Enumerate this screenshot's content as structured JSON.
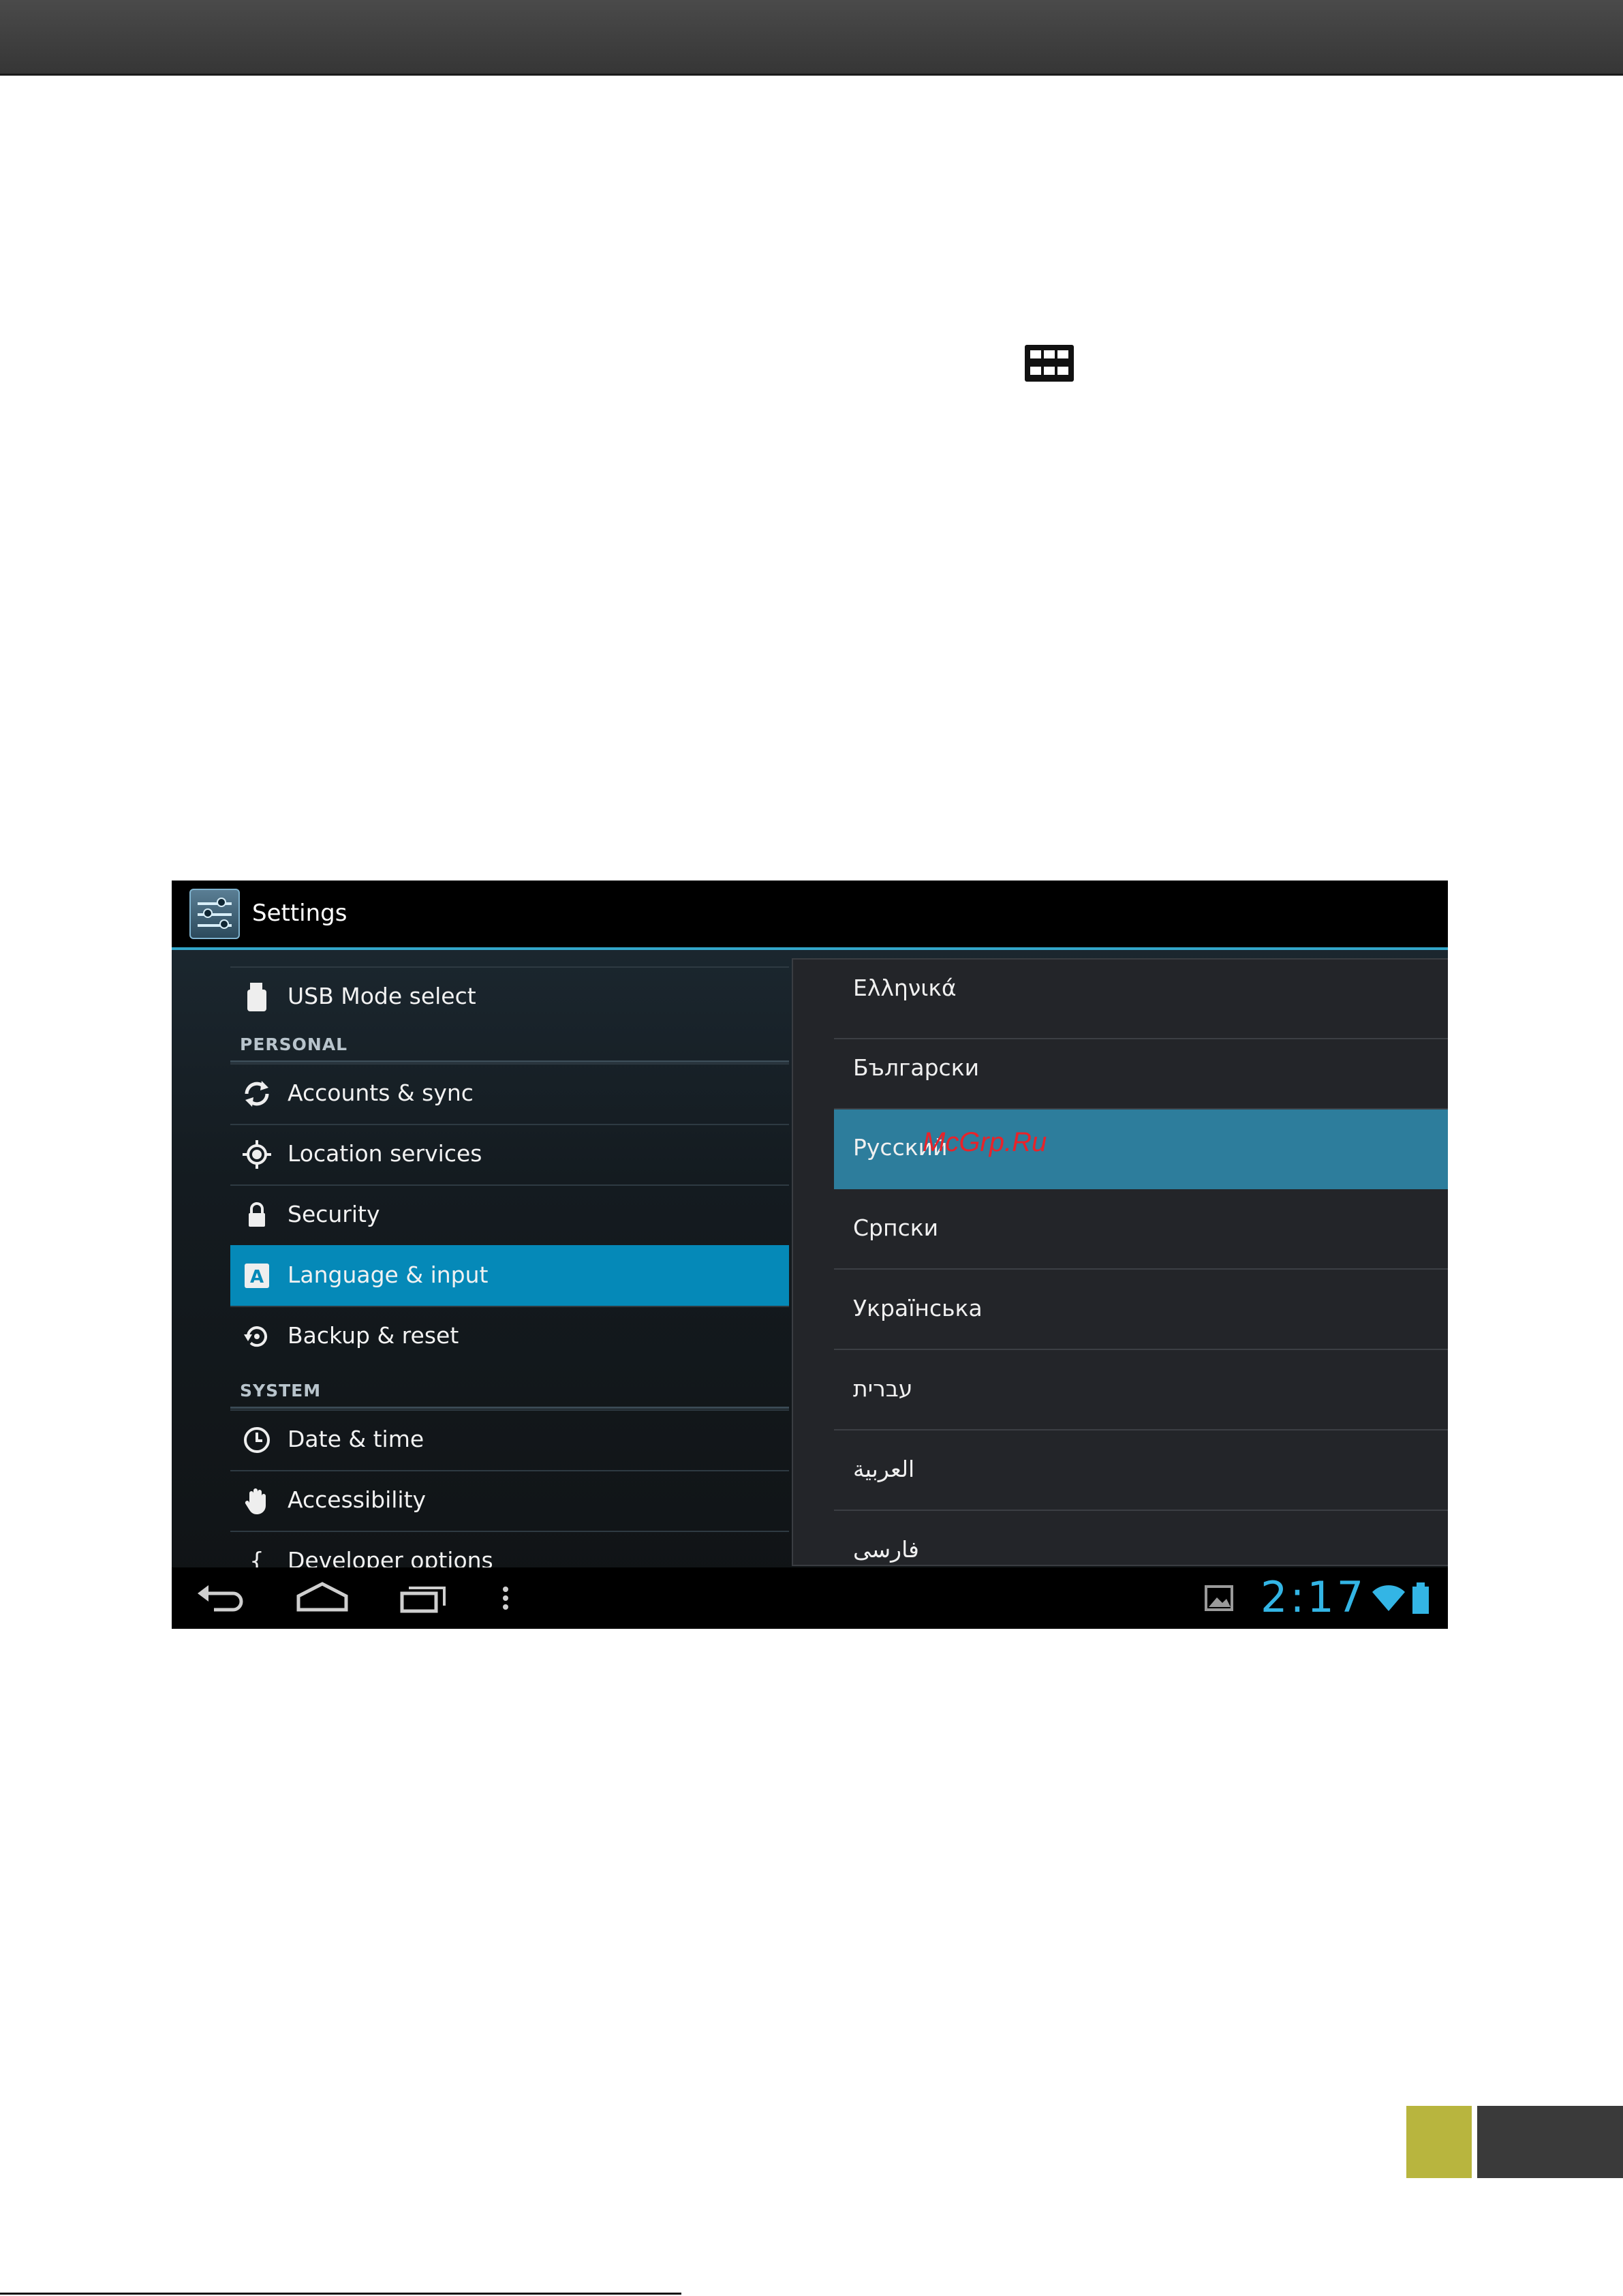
{
  "screen": {
    "app_title": "Settings",
    "settings": {
      "top_item": {
        "label": "USB Mode select",
        "icon": "usb-drive-icon"
      },
      "sections": [
        {
          "header": "PERSONAL",
          "items": [
            {
              "label": "Accounts & sync",
              "icon": "sync-icon"
            },
            {
              "label": "Location services",
              "icon": "location-icon"
            },
            {
              "label": "Security",
              "icon": "lock-icon"
            },
            {
              "label": "Language & input",
              "icon": "language-icon",
              "active": true
            },
            {
              "label": "Backup & reset",
              "icon": "backup-icon"
            }
          ]
        },
        {
          "header": "SYSTEM",
          "items": [
            {
              "label": "Date & time",
              "icon": "clock-icon"
            },
            {
              "label": "Accessibility",
              "icon": "hand-icon"
            },
            {
              "label": "Developer options",
              "icon": "braces-icon"
            }
          ]
        }
      ]
    },
    "languages": [
      {
        "label": "Ελληνικά"
      },
      {
        "label": "Български"
      },
      {
        "label": "Русский",
        "selected": true
      },
      {
        "label": "Српски"
      },
      {
        "label": "Українська"
      },
      {
        "label": "עברית"
      },
      {
        "label": "العربية"
      },
      {
        "label": "فارسی"
      }
    ],
    "watermark": "McGrp.Ru",
    "status": {
      "clock": "2:17"
    }
  },
  "colors": {
    "accent": "#33b5e5",
    "active_item": "#0589b8",
    "selected_language": "#2d7d9c",
    "corner_olive": "#b8b53e",
    "corner_dark": "#3a3a3a"
  }
}
